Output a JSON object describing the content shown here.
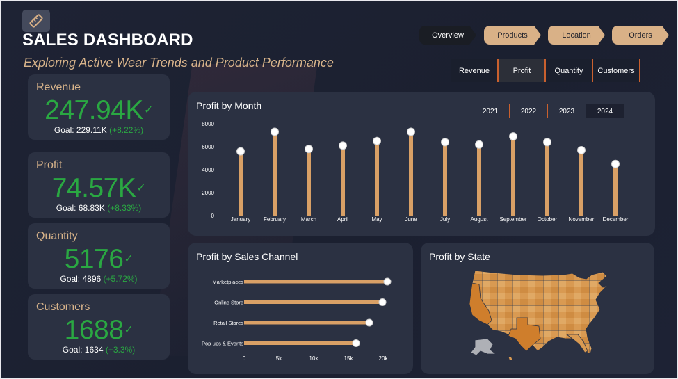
{
  "header": {
    "title": "SALES DASHBOARD",
    "subtitle": "Exploring Active Wear Trends and Product Performance",
    "logo_icon": "ruler-icon"
  },
  "nav": {
    "items": [
      {
        "label": "Overview",
        "active": true
      },
      {
        "label": "Products",
        "active": false
      },
      {
        "label": "Location",
        "active": false
      },
      {
        "label": "Orders",
        "active": false
      }
    ]
  },
  "metric_switch": {
    "items": [
      "Revenue",
      "Profit",
      "Quantity",
      "Customers"
    ],
    "selected": "Profit"
  },
  "kpis": [
    {
      "label": "Revenue",
      "value": "247.94K",
      "goal": "Goal: 229.11K",
      "delta": "(+8.22%)"
    },
    {
      "label": "Profit",
      "value": "74.57K",
      "goal": "Goal: 68.83K",
      "delta": "(+8.33%)"
    },
    {
      "label": "Quantity",
      "value": "5176",
      "goal": "Goal: 4896",
      "delta": "(+5.72%)"
    },
    {
      "label": "Customers",
      "value": "1688",
      "goal": "Goal: 1634",
      "delta": "(+3.3%)"
    }
  ],
  "colors": {
    "accent": "#d9a066",
    "positive": "#2aa842",
    "panel": "#2b3142",
    "background": "#1d2233",
    "divider": "#c9602e"
  },
  "profit_by_month": {
    "title": "Profit by Month",
    "years": [
      "2021",
      "2022",
      "2023",
      "2024"
    ],
    "selected_year": "2024"
  },
  "profit_by_channel": {
    "title": "Profit by Sales Channel"
  },
  "profit_by_state": {
    "title": "Profit by State"
  },
  "chart_data": [
    {
      "type": "lollipop",
      "title": "Profit by Month",
      "categories": [
        "January",
        "February",
        "March",
        "April",
        "May",
        "June",
        "July",
        "August",
        "September",
        "October",
        "November",
        "December"
      ],
      "values": [
        5600,
        7300,
        5800,
        6100,
        6500,
        7300,
        6400,
        6200,
        6900,
        6400,
        5700,
        4500
      ],
      "yticks": [
        "0",
        "2000",
        "4000",
        "6000",
        "8000"
      ],
      "ylim": [
        0,
        8000
      ],
      "grid": false
    },
    {
      "type": "lollipop-horizontal",
      "title": "Profit by Sales Channel",
      "categories": [
        "Marketplaces",
        "Online Store",
        "Retail Stores",
        "Pop-ups & Events"
      ],
      "values": [
        20600,
        19900,
        18000,
        16100
      ],
      "xticks": [
        "0",
        "5k",
        "10k",
        "15k",
        "20k"
      ],
      "xlim": [
        0,
        20000
      ],
      "grid": false
    }
  ]
}
